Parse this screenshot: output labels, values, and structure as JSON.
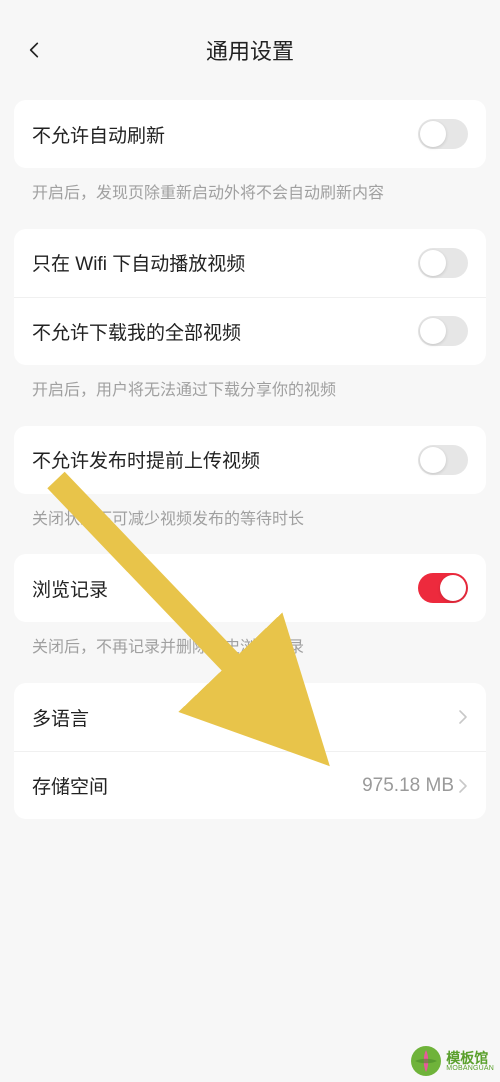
{
  "header": {
    "title": "通用设置"
  },
  "settings": {
    "auto_refresh": {
      "label": "不允许自动刷新",
      "on": false
    },
    "auto_refresh_desc": "开启后，发现页除重新启动外将不会自动刷新内容",
    "wifi_autoplay": {
      "label": "只在 Wifi 下自动播放视频",
      "on": false
    },
    "no_download": {
      "label": "不允许下载我的全部视频",
      "on": false
    },
    "no_download_desc": "开启后，用户将无法通过下载分享你的视频",
    "pre_upload": {
      "label": "不允许发布时提前上传视频",
      "on": false
    },
    "pre_upload_desc": "关闭状态下可减少视频发布的等待时长",
    "history": {
      "label": "浏览记录",
      "on": true
    },
    "history_desc": "关闭后，不再记录并删除历史浏览记录",
    "language": {
      "label": "多语言"
    },
    "storage": {
      "label": "存储空间",
      "value": "975.18 MB"
    }
  },
  "watermark": {
    "cn": "模板馆",
    "en": "MOBANGUAN"
  },
  "colors": {
    "accent": "#ed2a3d",
    "arrow": "#e8c44a"
  }
}
